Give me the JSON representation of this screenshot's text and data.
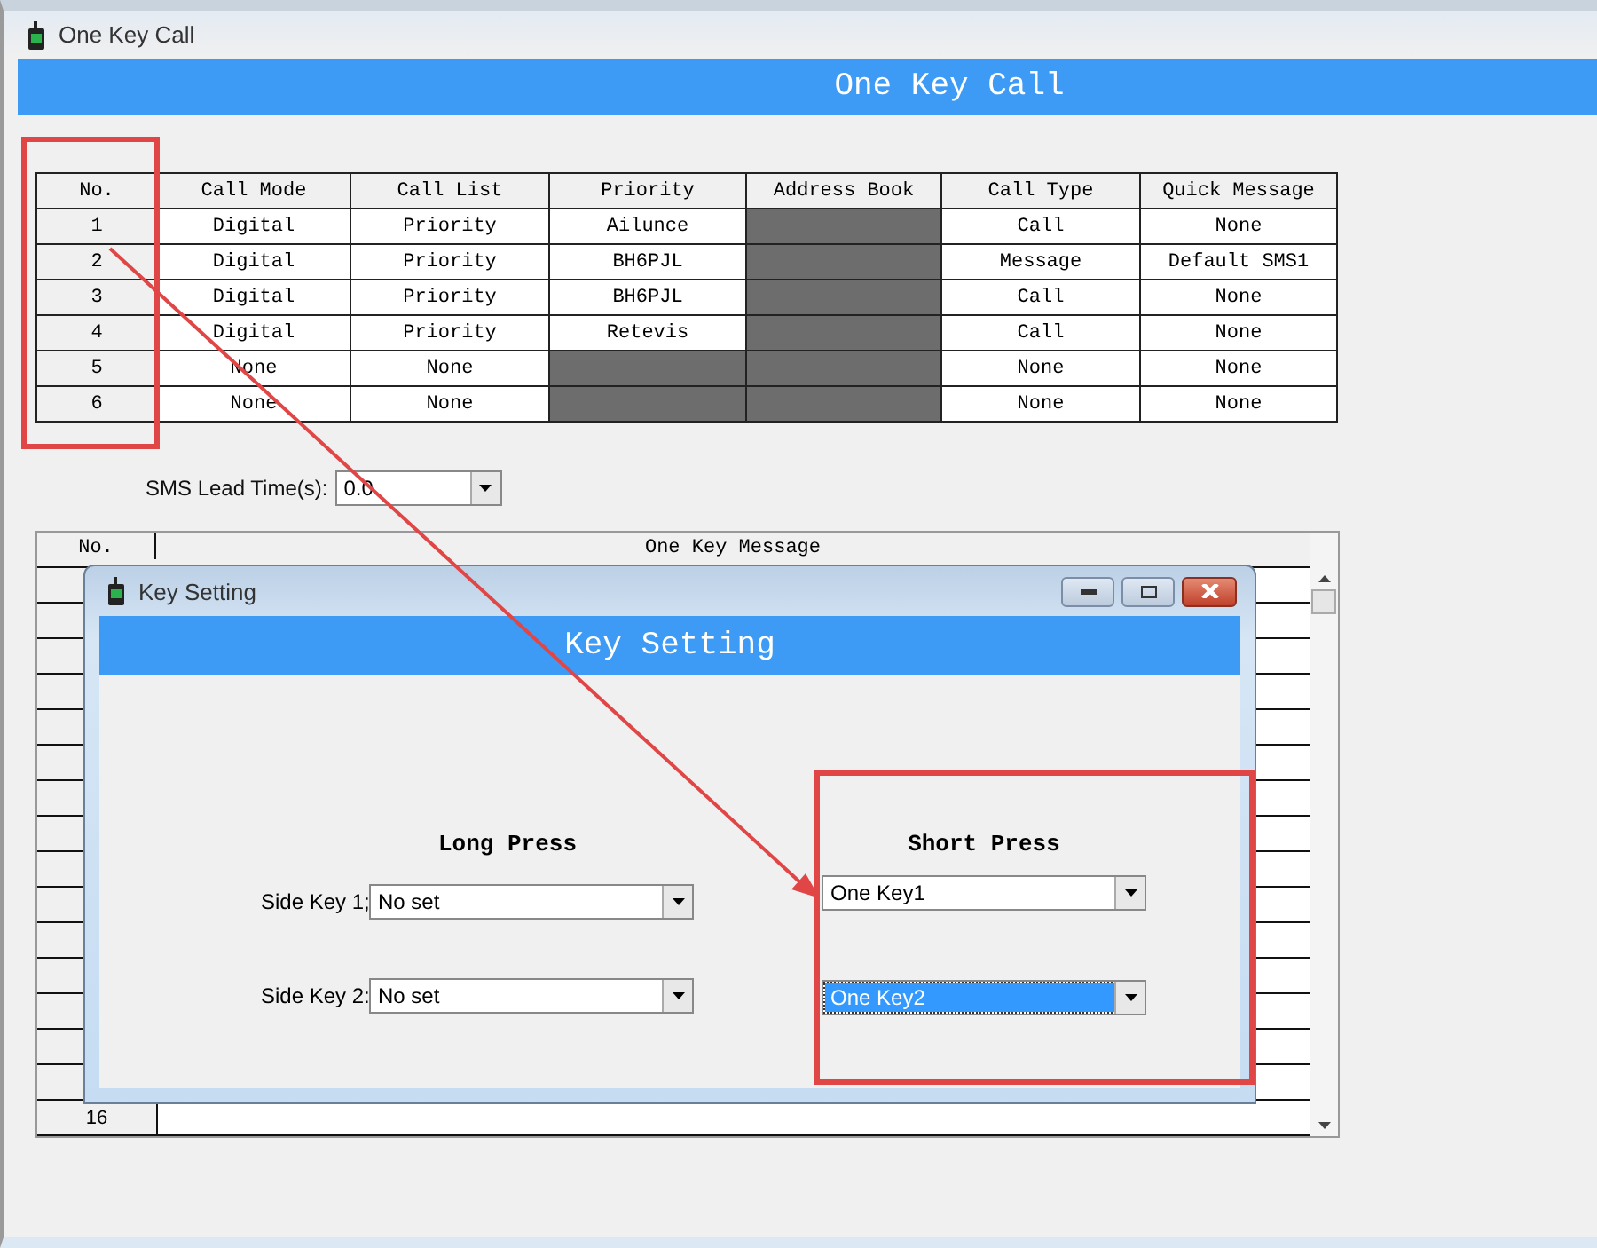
{
  "window": {
    "title": "One Key Call",
    "banner": "One Key Call"
  },
  "table": {
    "columns": [
      "No.",
      "Call Mode",
      "Call List",
      "Priority",
      "Address Book",
      "Call Type",
      "Quick Message"
    ],
    "rows": [
      {
        "cells": [
          {
            "text": "1",
            "disabled": false
          },
          {
            "text": "Digital",
            "disabled": false
          },
          {
            "text": "Priority",
            "disabled": false
          },
          {
            "text": "Ailunce",
            "disabled": false
          },
          {
            "disabled": true
          },
          {
            "text": "Call",
            "disabled": false
          },
          {
            "text": "None",
            "disabled": false
          }
        ]
      },
      {
        "cells": [
          {
            "text": "2",
            "disabled": false
          },
          {
            "text": "Digital",
            "disabled": false
          },
          {
            "text": "Priority",
            "disabled": false
          },
          {
            "text": "BH6PJL",
            "disabled": false
          },
          {
            "disabled": true
          },
          {
            "text": "Message",
            "disabled": false
          },
          {
            "text": "Default SMS1",
            "disabled": false
          }
        ]
      },
      {
        "cells": [
          {
            "text": "3",
            "disabled": false
          },
          {
            "text": "Digital",
            "disabled": false
          },
          {
            "text": "Priority",
            "disabled": false
          },
          {
            "text": "BH6PJL",
            "disabled": false
          },
          {
            "disabled": true
          },
          {
            "text": "Call",
            "disabled": false
          },
          {
            "text": "None",
            "disabled": false
          }
        ]
      },
      {
        "cells": [
          {
            "text": "4",
            "disabled": false
          },
          {
            "text": "Digital",
            "disabled": false
          },
          {
            "text": "Priority",
            "disabled": false
          },
          {
            "text": "Retevis",
            "disabled": false
          },
          {
            "disabled": true
          },
          {
            "text": "Call",
            "disabled": false
          },
          {
            "text": "None",
            "disabled": false
          }
        ]
      },
      {
        "cells": [
          {
            "text": "5",
            "disabled": false
          },
          {
            "text": "None",
            "disabled": false
          },
          {
            "text": "None",
            "disabled": false
          },
          {
            "disabled": true
          },
          {
            "disabled": true
          },
          {
            "text": "None",
            "disabled": false
          },
          {
            "text": "None",
            "disabled": false
          }
        ]
      },
      {
        "cells": [
          {
            "text": "6",
            "disabled": false
          },
          {
            "text": "None",
            "disabled": false
          },
          {
            "text": "None",
            "disabled": false
          },
          {
            "disabled": true
          },
          {
            "disabled": true
          },
          {
            "text": "None",
            "disabled": false
          },
          {
            "text": "None",
            "disabled": false
          }
        ]
      }
    ]
  },
  "sms_lead_time": {
    "label": "SMS Lead Time(s):",
    "value": "0.0"
  },
  "message_table": {
    "columns": [
      "No.",
      "One Key Message"
    ],
    "rows": [
      {
        "no": "16"
      }
    ]
  },
  "dialog": {
    "title": "Key Setting",
    "banner": "Key Setting",
    "long_press": {
      "heading": "Long Press",
      "fields": [
        {
          "label": "Side Key 1;",
          "value": "No set",
          "selected": false
        },
        {
          "label": "Side Key 2:",
          "value": "No set",
          "selected": false
        }
      ]
    },
    "short_press": {
      "heading": "Short Press",
      "fields": [
        {
          "value": "One Key1",
          "selected": false
        },
        {
          "value": "One Key2",
          "selected": true
        }
      ]
    }
  }
}
